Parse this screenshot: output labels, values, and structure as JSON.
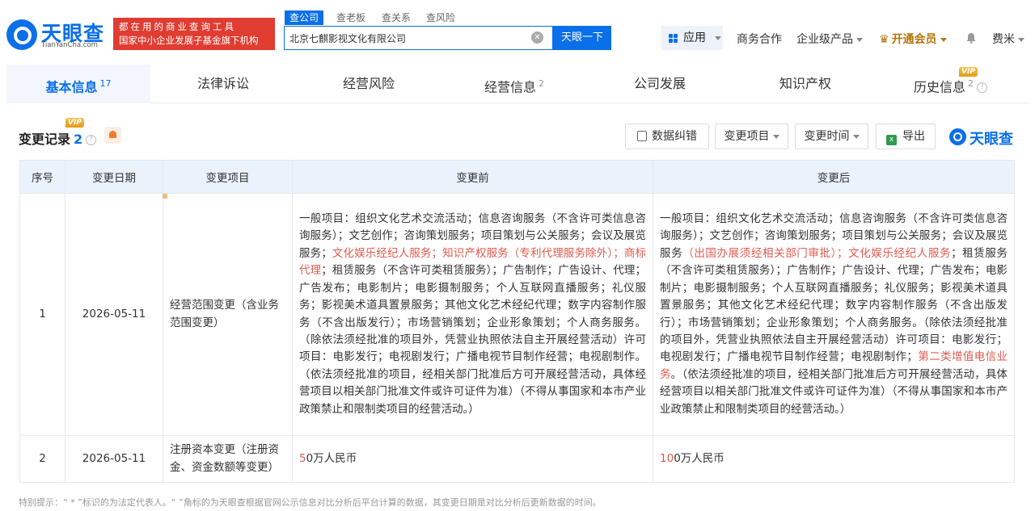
{
  "brand": {
    "name": "天眼查",
    "domain": "TianYanCha.com",
    "slogan_line1": "都在用的商业查询工具",
    "slogan_line2": "国家中小企业发展子基金旗下机构"
  },
  "search": {
    "tabs": [
      "查公司",
      "查老板",
      "查关系",
      "查风险"
    ],
    "value": "北京七麒影视文化有限公司",
    "button": "天眼一下"
  },
  "topnav": {
    "apps": "应用",
    "business": "商务合作",
    "enterprise": "企业级产品",
    "vip": "开通会员",
    "user": "费米"
  },
  "tabs": [
    {
      "label": "基本信息",
      "count": "17"
    },
    {
      "label": "法律诉讼",
      "count": ""
    },
    {
      "label": "经营风险",
      "count": ""
    },
    {
      "label": "经营信息",
      "count": "2"
    },
    {
      "label": "公司发展",
      "count": ""
    },
    {
      "label": "知识产权",
      "count": ""
    },
    {
      "label": "历史信息",
      "count": "2",
      "badge": "VIP"
    }
  ],
  "section": {
    "title": "变更记录",
    "count": "2",
    "badge": "VIP"
  },
  "toolbar": {
    "correct": "数据纠错",
    "item": "变更项目",
    "time": "变更时间",
    "export": "导出",
    "brand": "天眼查"
  },
  "table": {
    "headers": [
      "序号",
      "变更日期",
      "变更项目",
      "变更前",
      "变更后"
    ],
    "rows": [
      {
        "no": "1",
        "date": "2026-05-11",
        "item": "经营范围变更（含业务范围变更）",
        "before": {
          "p1": "一般项目：组织文化艺术交流活动；信息咨询服务（不含许可类信息咨询服务）；文艺创作；咨询策划服务；项目策划与公关服务；会议及展览服务；",
          "hl": "文化娱乐经纪人服务；知识产权服务（专利代理服务除外）；商标代理",
          "p2": "；租赁服务（不含许可类租赁服务）；广告制作；广告设计、代理；广告发布；电影制片；电影摄制服务；个人互联网直播服务；礼仪服务；影视美术道具置景服务；其他文化艺术经纪代理；数字内容制作服务（不含出版发行）；市场营销策划；企业形象策划；个人商务服务。（除依法须经批准的项目外，凭营业执照依法自主开展经营活动）许可项目：电影发行；电视剧发行；广播电视节目制作经营；电视剧制作。（依法须经批准的项目，经相关部门批准后方可开展经营活动，具体经营项目以相关部门批准文件或许可证件为准）（不得从事国家和本市产业政策禁止和限制类项目的经营活动。）"
        },
        "after": {
          "p1": "一般项目：组织文化艺术交流活动；信息咨询服务（不含许可类信息咨询服务）；文艺创作；咨询策划服务；项目策划与公关服务；会议及展览服务",
          "hl1": "（出国办展须经相关部门审批）；文化娱乐经纪人服务",
          "p2": "；租赁服务（不含许可类租赁服务）；广告制作；广告设计、代理；广告发布；电影制片；电影摄制服务；个人互联网直播服务；礼仪服务；影视美术道具置景服务；其他文化艺术经纪代理；数字内容制作服务（不含出版发行）；市场营销策划；企业形象策划；个人商务服务。（除依法须经批准的项目外，凭营业执照依法自主开展经营活动）许可项目：电影发行；电视剧发行；广播电视节目制作经营；电视剧制作；",
          "hl2": "第二类增值电信业务",
          "p3": "。（依法须经批准的项目，经相关部门批准后方可开展经营活动，具体经营项目以相关部门批准文件或许可证件为准）（不得从事国家和本市产业政策禁止和限制类项目的经营活动。）"
        }
      },
      {
        "no": "2",
        "date": "2026-05-11",
        "item": "注册资本变更（注册资金、资金数额等变更）",
        "before": {
          "hl": "5",
          "p": "0万人民币"
        },
        "after": {
          "hl": "10",
          "p": "0万人民币"
        }
      }
    ]
  },
  "note": "特别提示：“ * ”标识的为法定代表人。“ ”角标的为天眼查根据官网公示信息对比分析后平台计算的数据，其变更日期是对比分析后更新数据的时间。",
  "colors": {
    "brand_blue": "#0a6fe8",
    "slogan_red": "#e03c31",
    "highlight_red": "#e05a4e",
    "vip_gold": "#b3740b"
  }
}
